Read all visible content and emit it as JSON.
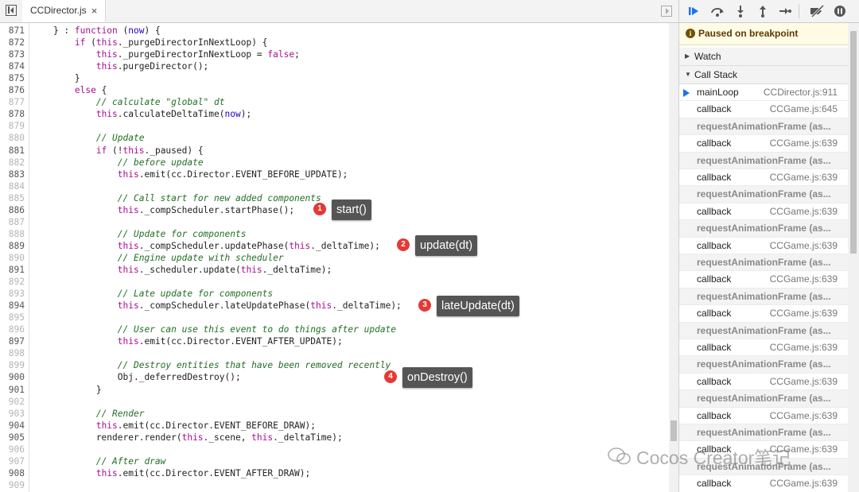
{
  "editor": {
    "tab": {
      "filename": "CCDirector.js",
      "close_glyph": "×"
    },
    "lines": [
      {
        "n": "871",
        "tokens": [
          [
            "    } : ",
            ""
          ],
          [
            "function",
            "kw"
          ],
          [
            " (",
            ""
          ],
          [
            "now",
            "vr"
          ],
          [
            ") {",
            ""
          ]
        ]
      },
      {
        "n": "872",
        "tokens": [
          [
            "        ",
            ""
          ],
          [
            "if",
            "kw"
          ],
          [
            " (",
            ""
          ],
          [
            "this",
            "kw"
          ],
          [
            "._purgeDirectorInNextLoop) {",
            ""
          ]
        ]
      },
      {
        "n": "873",
        "tokens": [
          [
            "            ",
            ""
          ],
          [
            "this",
            "kw"
          ],
          [
            "._purgeDirectorInNextLoop = ",
            ""
          ],
          [
            "false",
            "kw"
          ],
          [
            ";",
            ""
          ]
        ]
      },
      {
        "n": "874",
        "tokens": [
          [
            "            ",
            ""
          ],
          [
            "this",
            "kw"
          ],
          [
            ".purgeDirector();",
            ""
          ]
        ]
      },
      {
        "n": "875",
        "tokens": [
          [
            "        }",
            ""
          ]
        ]
      },
      {
        "n": "876",
        "tokens": [
          [
            "        ",
            ""
          ],
          [
            "else",
            "kw"
          ],
          [
            " {",
            ""
          ]
        ]
      },
      {
        "n": "877",
        "tokens": [
          [
            "            ",
            ""
          ],
          [
            "// calculate \"global\" dt",
            "cm"
          ]
        ]
      },
      {
        "n": "878",
        "tokens": [
          [
            "            ",
            ""
          ],
          [
            "this",
            "kw"
          ],
          [
            ".calculateDeltaTime(",
            ""
          ],
          [
            "now",
            "vr"
          ],
          [
            ");",
            ""
          ]
        ]
      },
      {
        "n": "879",
        "tokens": []
      },
      {
        "n": "880",
        "tokens": [
          [
            "            ",
            ""
          ],
          [
            "// Update",
            "cm"
          ]
        ]
      },
      {
        "n": "881",
        "tokens": [
          [
            "            ",
            ""
          ],
          [
            "if",
            "kw"
          ],
          [
            " (!",
            ""
          ],
          [
            "this",
            "kw"
          ],
          [
            "._paused) {",
            ""
          ]
        ]
      },
      {
        "n": "882",
        "tokens": [
          [
            "                ",
            ""
          ],
          [
            "// before update",
            "cm"
          ]
        ]
      },
      {
        "n": "883",
        "tokens": [
          [
            "                ",
            ""
          ],
          [
            "this",
            "kw"
          ],
          [
            ".emit(cc.Director.EVENT_BEFORE_UPDATE);",
            ""
          ]
        ]
      },
      {
        "n": "884",
        "tokens": []
      },
      {
        "n": "885",
        "tokens": [
          [
            "                ",
            ""
          ],
          [
            "// Call start for new added components",
            "cm"
          ]
        ]
      },
      {
        "n": "886",
        "tokens": [
          [
            "                ",
            ""
          ],
          [
            "this",
            "kw"
          ],
          [
            "._compScheduler.startPhase();",
            ""
          ]
        ]
      },
      {
        "n": "887",
        "tokens": []
      },
      {
        "n": "888",
        "tokens": [
          [
            "                ",
            ""
          ],
          [
            "// Update for components",
            "cm"
          ]
        ]
      },
      {
        "n": "889",
        "tokens": [
          [
            "                ",
            ""
          ],
          [
            "this",
            "kw"
          ],
          [
            "._compScheduler.updatePhase(",
            ""
          ],
          [
            "this",
            "kw"
          ],
          [
            "._deltaTime);",
            ""
          ]
        ]
      },
      {
        "n": "890",
        "tokens": [
          [
            "                ",
            ""
          ],
          [
            "// Engine update with scheduler",
            "cm"
          ]
        ]
      },
      {
        "n": "891",
        "tokens": [
          [
            "                ",
            ""
          ],
          [
            "this",
            "kw"
          ],
          [
            "._scheduler.update(",
            ""
          ],
          [
            "this",
            "kw"
          ],
          [
            "._deltaTime);",
            ""
          ]
        ]
      },
      {
        "n": "892",
        "tokens": []
      },
      {
        "n": "893",
        "tokens": [
          [
            "                ",
            ""
          ],
          [
            "// Late update for components",
            "cm"
          ]
        ]
      },
      {
        "n": "894",
        "tokens": [
          [
            "                ",
            ""
          ],
          [
            "this",
            "kw"
          ],
          [
            "._compScheduler.lateUpdatePhase(",
            ""
          ],
          [
            "this",
            "kw"
          ],
          [
            "._deltaTime);",
            ""
          ]
        ]
      },
      {
        "n": "895",
        "tokens": []
      },
      {
        "n": "896",
        "tokens": [
          [
            "                ",
            ""
          ],
          [
            "// User can use this event to do things after update",
            "cm"
          ]
        ]
      },
      {
        "n": "897",
        "tokens": [
          [
            "                ",
            ""
          ],
          [
            "this",
            "kw"
          ],
          [
            ".emit(cc.Director.EVENT_AFTER_UPDATE);",
            ""
          ]
        ]
      },
      {
        "n": "898",
        "tokens": []
      },
      {
        "n": "899",
        "tokens": [
          [
            "                ",
            ""
          ],
          [
            "// Destroy entities that have been removed recently",
            "cm"
          ]
        ]
      },
      {
        "n": "900",
        "tokens": [
          [
            "                Obj._deferredDestroy();",
            ""
          ]
        ]
      },
      {
        "n": "901",
        "tokens": [
          [
            "            }",
            ""
          ]
        ]
      },
      {
        "n": "902",
        "tokens": []
      },
      {
        "n": "903",
        "tokens": [
          [
            "            ",
            ""
          ],
          [
            "// Render",
            "cm"
          ]
        ]
      },
      {
        "n": "904",
        "tokens": [
          [
            "            ",
            ""
          ],
          [
            "this",
            "kw"
          ],
          [
            ".emit(cc.Director.EVENT_BEFORE_DRAW);",
            ""
          ]
        ]
      },
      {
        "n": "905",
        "tokens": [
          [
            "            renderer.render(",
            ""
          ],
          [
            "this",
            "kw"
          ],
          [
            "._scene, ",
            ""
          ],
          [
            "this",
            "kw"
          ],
          [
            "._deltaTime);",
            ""
          ]
        ]
      },
      {
        "n": "906",
        "tokens": []
      },
      {
        "n": "907",
        "tokens": [
          [
            "            ",
            ""
          ],
          [
            "// After draw",
            "cm"
          ]
        ]
      },
      {
        "n": "908",
        "tokens": [
          [
            "            ",
            ""
          ],
          [
            "this",
            "kw"
          ],
          [
            ".emit(cc.Director.EVENT_AFTER_DRAW);",
            ""
          ]
        ]
      },
      {
        "n": "909",
        "tokens": []
      }
    ],
    "annotations": [
      {
        "num": "1",
        "label": "start()"
      },
      {
        "num": "2",
        "label": "update(dt)"
      },
      {
        "num": "3",
        "label": "lateUpdate(dt)"
      },
      {
        "num": "4",
        "label": "onDestroy()"
      }
    ]
  },
  "debugger": {
    "paused_text": "Paused on breakpoint",
    "info_glyph": "i",
    "watch_label": "Watch",
    "call_stack_label": "Call Stack",
    "frames": [
      {
        "fn": "mainLoop",
        "loc": "CCDirector.js:911",
        "kind": "current"
      },
      {
        "fn": "callback",
        "loc": "CCGame.js:645",
        "kind": "normal"
      },
      {
        "fn": "requestAnimationFrame (as...",
        "loc": "",
        "kind": "async"
      },
      {
        "fn": "callback",
        "loc": "CCGame.js:639",
        "kind": "normal"
      },
      {
        "fn": "requestAnimationFrame (as...",
        "loc": "",
        "kind": "async"
      },
      {
        "fn": "callback",
        "loc": "CCGame.js:639",
        "kind": "normal"
      },
      {
        "fn": "requestAnimationFrame (as...",
        "loc": "",
        "kind": "async"
      },
      {
        "fn": "callback",
        "loc": "CCGame.js:639",
        "kind": "normal"
      },
      {
        "fn": "requestAnimationFrame (as...",
        "loc": "",
        "kind": "async"
      },
      {
        "fn": "callback",
        "loc": "CCGame.js:639",
        "kind": "normal"
      },
      {
        "fn": "requestAnimationFrame (as...",
        "loc": "",
        "kind": "async"
      },
      {
        "fn": "callback",
        "loc": "CCGame.js:639",
        "kind": "normal"
      },
      {
        "fn": "requestAnimationFrame (as...",
        "loc": "",
        "kind": "async"
      },
      {
        "fn": "callback",
        "loc": "CCGame.js:639",
        "kind": "normal"
      },
      {
        "fn": "requestAnimationFrame (as...",
        "loc": "",
        "kind": "async"
      },
      {
        "fn": "callback",
        "loc": "CCGame.js:639",
        "kind": "normal"
      },
      {
        "fn": "requestAnimationFrame (as...",
        "loc": "",
        "kind": "async"
      },
      {
        "fn": "callback",
        "loc": "CCGame.js:639",
        "kind": "normal"
      },
      {
        "fn": "requestAnimationFrame (as...",
        "loc": "",
        "kind": "async"
      },
      {
        "fn": "callback",
        "loc": "CCGame.js:639",
        "kind": "normal"
      },
      {
        "fn": "requestAnimationFrame (as...",
        "loc": "",
        "kind": "async"
      },
      {
        "fn": "callback",
        "loc": "CCGame.js:639",
        "kind": "normal"
      },
      {
        "fn": "requestAnimationFrame (as...",
        "loc": "",
        "kind": "async"
      },
      {
        "fn": "callback",
        "loc": "CCGame.js:639",
        "kind": "normal"
      }
    ],
    "toolbar_icons": [
      "resume-icon",
      "step-over-icon",
      "step-into-icon",
      "step-out-icon",
      "step-icon",
      "deactivate-breakpoints-icon",
      "pause-on-exceptions-icon"
    ]
  },
  "watermark": {
    "text": "Cocos Creator笔记"
  },
  "colors": {
    "accent": "#1a73e8",
    "badge": "#e53935",
    "annotation_bg": "#555555",
    "keyword": "#aa0d91",
    "comment": "#236e25"
  }
}
